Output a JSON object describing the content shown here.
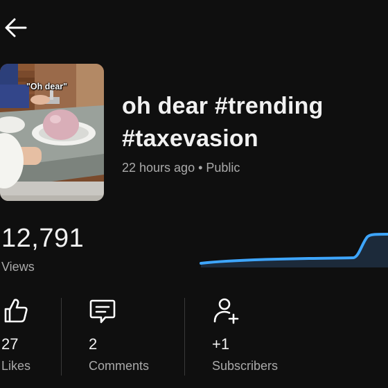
{
  "header": {
    "back_icon": "arrow-left-icon"
  },
  "video": {
    "thumbnail_caption": "\"Oh dear\"",
    "title": "oh dear #trending #taxevasion",
    "meta": "22 hours ago • Public"
  },
  "views": {
    "value": "12,791",
    "label": "Views",
    "trend_color": "#3ea6ff"
  },
  "stats": {
    "likes": {
      "value": "27",
      "label": "Likes",
      "icon": "thumbs-up-icon"
    },
    "comments": {
      "value": "2",
      "label": "Comments",
      "icon": "comment-icon"
    },
    "subscribers": {
      "value": "+1",
      "label": "Subscribers",
      "icon": "add-person-icon"
    }
  },
  "colors": {
    "background": "#0f0f0f",
    "text_primary": "#f1f1f1",
    "text_secondary": "#aaaaaa",
    "accent_blue": "#3ea6ff"
  }
}
